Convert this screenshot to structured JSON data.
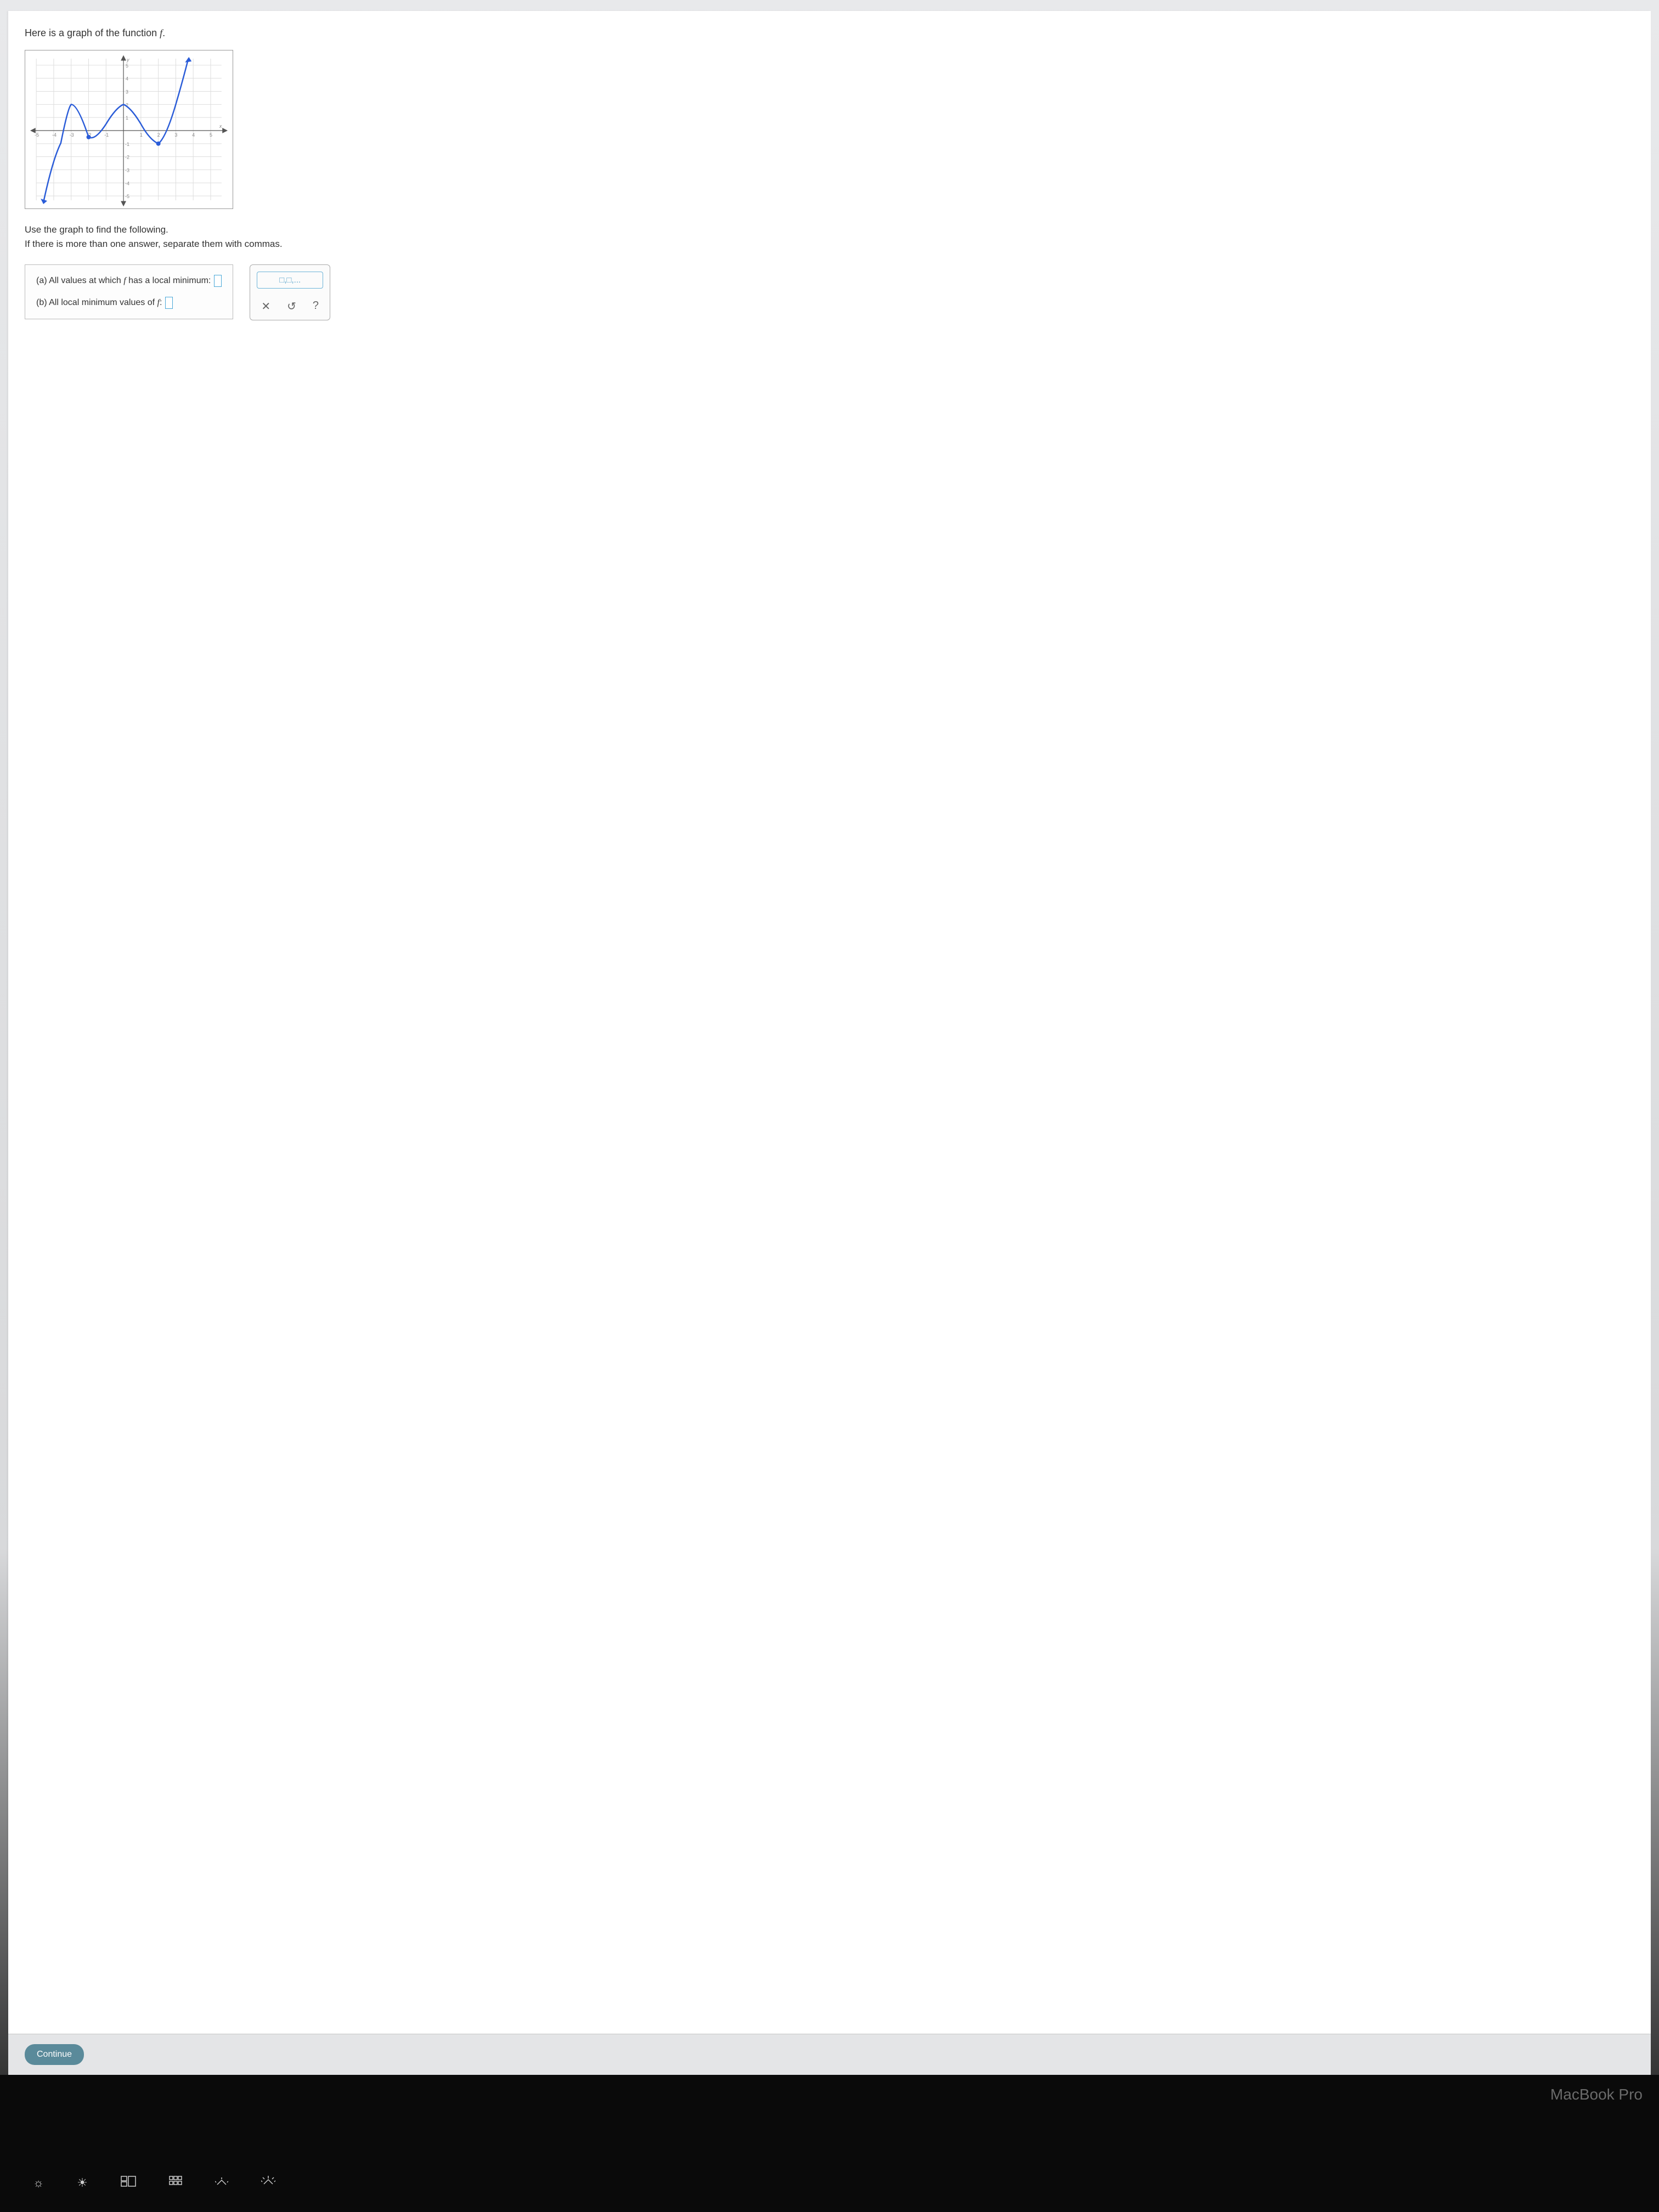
{
  "prompt": "Here is a graph of the function ",
  "prompt_fn": "f",
  "prompt_end": ".",
  "instructions_line1": "Use the graph to find the following.",
  "instructions_line2": "If there is more than one answer, separate them with commas.",
  "question_a_prefix": "(a) All values at which ",
  "question_a_fn": "f",
  "question_a_suffix": " has a local minimum: ",
  "question_b_prefix": "(b) All local minimum values of ",
  "question_b_fn": "f",
  "question_b_suffix": ": ",
  "tool_list_hint": "□,□,...",
  "tool_clear": "✕",
  "tool_reset": "↺",
  "tool_help": "?",
  "continue_label": "Continue",
  "macbook": "MacBook Pro",
  "chart_data": {
    "type": "line",
    "xlabel": "x",
    "ylabel": "y",
    "xlim": [
      -5.5,
      5.5
    ],
    "ylim": [
      -5.5,
      5.5
    ],
    "x_ticks": [
      -5,
      -4,
      -3,
      -2,
      -1,
      1,
      2,
      3,
      4,
      5
    ],
    "y_ticks": [
      -5,
      -4,
      -3,
      -2,
      -1,
      1,
      2,
      3,
      4,
      5
    ],
    "series": [
      {
        "name": "f",
        "points": [
          [
            -4.6,
            -5.5
          ],
          [
            -4.0,
            -1.0
          ],
          [
            -3.4,
            1.5
          ],
          [
            -3.0,
            2.0
          ],
          [
            -2.6,
            1.5
          ],
          [
            -2.0,
            -0.5
          ],
          [
            -1.6,
            -0.8
          ],
          [
            -1.0,
            0.5
          ],
          [
            -0.4,
            1.7
          ],
          [
            0.0,
            2.0
          ],
          [
            0.4,
            1.7
          ],
          [
            1.0,
            0.5
          ],
          [
            1.5,
            -0.7
          ],
          [
            2.0,
            -1.0
          ],
          [
            2.4,
            -0.5
          ],
          [
            3.0,
            2.0
          ],
          [
            3.4,
            4.0
          ],
          [
            3.7,
            5.5
          ]
        ],
        "closed_points": [
          [
            -2,
            -0.5
          ],
          [
            2,
            -1
          ]
        ],
        "arrows": [
          "start",
          "end"
        ]
      }
    ]
  }
}
